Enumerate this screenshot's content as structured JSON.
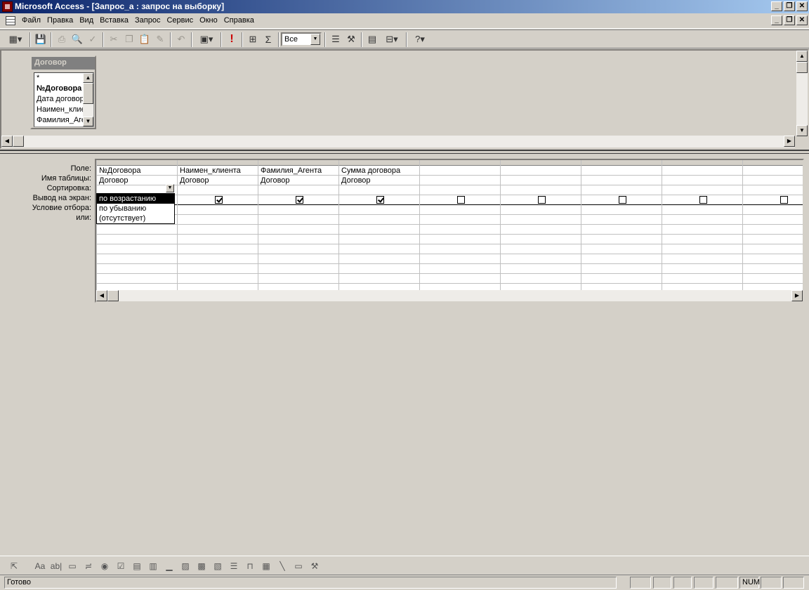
{
  "window": {
    "title": "Microsoft Access - [Запрос_а : запрос на выборку]"
  },
  "menu": {
    "items": [
      "Файл",
      "Правка",
      "Вид",
      "Вставка",
      "Запрос",
      "Сервис",
      "Окно",
      "Справка"
    ]
  },
  "toolbar": {
    "top_values": "Все",
    "run_label": "!",
    "totals_label": "Σ"
  },
  "table_box": {
    "title": "Договор",
    "fields": [
      "*",
      "№Договора",
      "Дата договора",
      "Наимен_клиента",
      "Фамилия_Агента"
    ]
  },
  "grid": {
    "row_labels": [
      "Поле:",
      "Имя таблицы:",
      "Сортировка:",
      "Вывод на экран:",
      "Условие отбора:",
      "или:"
    ],
    "columns": [
      {
        "field": "№Договора",
        "table": "Договор",
        "show": true
      },
      {
        "field": "Наимен_клиента",
        "table": "Договор",
        "show": true
      },
      {
        "field": "Фамилия_Агента",
        "table": "Договор",
        "show": true
      },
      {
        "field": "Сумма договора",
        "table": "Договор",
        "show": true
      },
      {
        "field": "",
        "table": "",
        "show": false
      },
      {
        "field": "",
        "table": "",
        "show": false
      },
      {
        "field": "",
        "table": "",
        "show": false
      },
      {
        "field": "",
        "table": "",
        "show": false
      },
      {
        "field": "",
        "table": "",
        "show": false
      }
    ]
  },
  "sort_dropdown": {
    "options": [
      "по возрастанию",
      "по убыванию",
      "(отсутствует)"
    ],
    "selected_index": 0
  },
  "status": {
    "text": "Готово",
    "num": "NUM"
  }
}
